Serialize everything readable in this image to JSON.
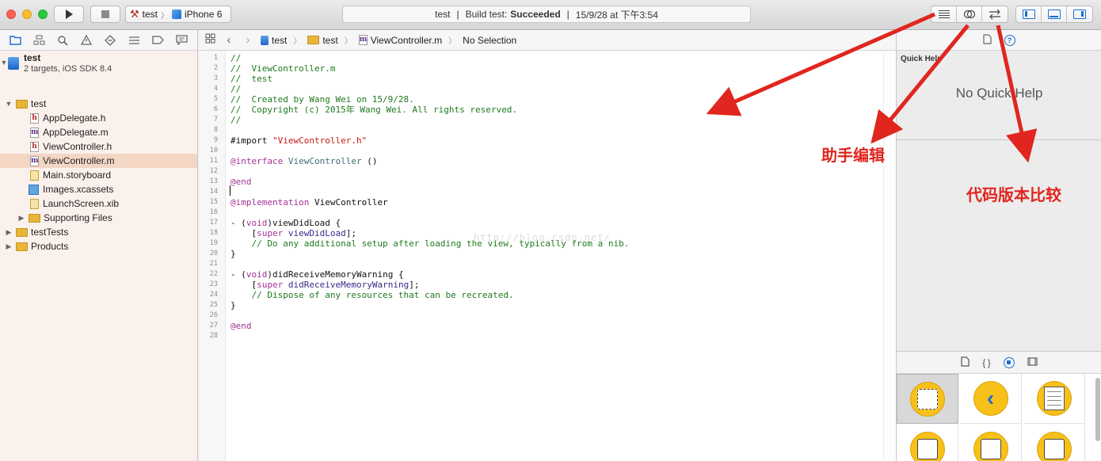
{
  "toolbar": {
    "scheme": "test",
    "device": "iPhone 6",
    "status_project": "test",
    "status_action": "Build test:",
    "status_result": "Succeeded",
    "status_time": "15/9/28 at 下午3:54"
  },
  "navigator": {
    "project_name": "test",
    "project_subtitle": "2 targets, iOS SDK 8.4",
    "items": [
      {
        "label": "test",
        "kind": "folder",
        "indent": 1,
        "open": true
      },
      {
        "label": "AppDelegate.h",
        "kind": "h",
        "indent": 2
      },
      {
        "label": "AppDelegate.m",
        "kind": "m",
        "indent": 2
      },
      {
        "label": "ViewController.h",
        "kind": "h",
        "indent": 2
      },
      {
        "label": "ViewController.m",
        "kind": "m",
        "indent": 2,
        "selected": true
      },
      {
        "label": "Main.storyboard",
        "kind": "sb",
        "indent": 2
      },
      {
        "label": "Images.xcassets",
        "kind": "xc",
        "indent": 2
      },
      {
        "label": "LaunchScreen.xib",
        "kind": "xib",
        "indent": 2
      },
      {
        "label": "Supporting Files",
        "kind": "folder",
        "indent": 2,
        "open": false
      },
      {
        "label": "testTests",
        "kind": "folder",
        "indent": 1,
        "open": false
      },
      {
        "label": "Products",
        "kind": "folder",
        "indent": 1,
        "open": false
      }
    ]
  },
  "jumpbar": {
    "project": "test",
    "group": "test",
    "file": "ViewController.m",
    "selection": "No Selection"
  },
  "editor": {
    "lines": [
      [
        {
          "t": "//",
          "c": "c-comment"
        }
      ],
      [
        {
          "t": "//  ViewController.m",
          "c": "c-comment"
        }
      ],
      [
        {
          "t": "//  test",
          "c": "c-comment"
        }
      ],
      [
        {
          "t": "//",
          "c": "c-comment"
        }
      ],
      [
        {
          "t": "//  Created by Wang Wei on 15/9/28.",
          "c": "c-comment"
        }
      ],
      [
        {
          "t": "//  Copyright (c) 2015年 Wang Wei. All rights reserved.",
          "c": "c-comment"
        }
      ],
      [
        {
          "t": "//",
          "c": "c-comment"
        }
      ],
      [],
      [
        {
          "t": "#import ",
          "c": "c-plain"
        },
        {
          "t": "\"ViewController.h\"",
          "c": "c-str"
        }
      ],
      [],
      [
        {
          "t": "@interface ",
          "c": "c-kw"
        },
        {
          "t": "ViewController",
          "c": "c-cls"
        },
        {
          "t": " ()",
          "c": "c-plain"
        }
      ],
      [],
      [
        {
          "t": "@end",
          "c": "c-kw"
        }
      ],
      [],
      [
        {
          "t": "@implementation ",
          "c": "c-kw"
        },
        {
          "t": "ViewController",
          "c": "c-plain"
        }
      ],
      [],
      [
        {
          "t": "- (",
          "c": "c-plain"
        },
        {
          "t": "void",
          "c": "c-kw"
        },
        {
          "t": ")viewDidLoad {",
          "c": "c-plain"
        }
      ],
      [
        {
          "t": "    [",
          "c": "c-plain"
        },
        {
          "t": "super",
          "c": "c-kw"
        },
        {
          "t": " ",
          "c": "c-plain"
        },
        {
          "t": "viewDidLoad",
          "c": "c-call"
        },
        {
          "t": "];",
          "c": "c-plain"
        }
      ],
      [
        {
          "t": "    // Do any additional setup after loading the view, typically from a nib.",
          "c": "c-comment"
        }
      ],
      [
        {
          "t": "}",
          "c": "c-plain"
        }
      ],
      [],
      [
        {
          "t": "- (",
          "c": "c-plain"
        },
        {
          "t": "void",
          "c": "c-kw"
        },
        {
          "t": ")didReceiveMemoryWarning {",
          "c": "c-plain"
        }
      ],
      [
        {
          "t": "    [",
          "c": "c-plain"
        },
        {
          "t": "super",
          "c": "c-kw"
        },
        {
          "t": " ",
          "c": "c-plain"
        },
        {
          "t": "didReceiveMemoryWarning",
          "c": "c-call"
        },
        {
          "t": "];",
          "c": "c-plain"
        }
      ],
      [
        {
          "t": "    // Dispose of any resources that can be recreated.",
          "c": "c-comment"
        }
      ],
      [
        {
          "t": "}",
          "c": "c-plain"
        }
      ],
      [],
      [
        {
          "t": "@end",
          "c": "c-kw"
        }
      ],
      []
    ],
    "watermark": "http://blog.csdn.net/"
  },
  "inspector": {
    "quick_help_title": "Quick Help",
    "quick_help_empty": "No Quick Help"
  },
  "annotations": {
    "assistant_editor": "助手编辑",
    "version_compare": "代码版本比较",
    "arrow_color": "#e0261e"
  },
  "colors": {
    "navigator_bg": "#fbf1ec",
    "selection_bg": "#f4d6c5",
    "accent": "#1b6fd0"
  }
}
